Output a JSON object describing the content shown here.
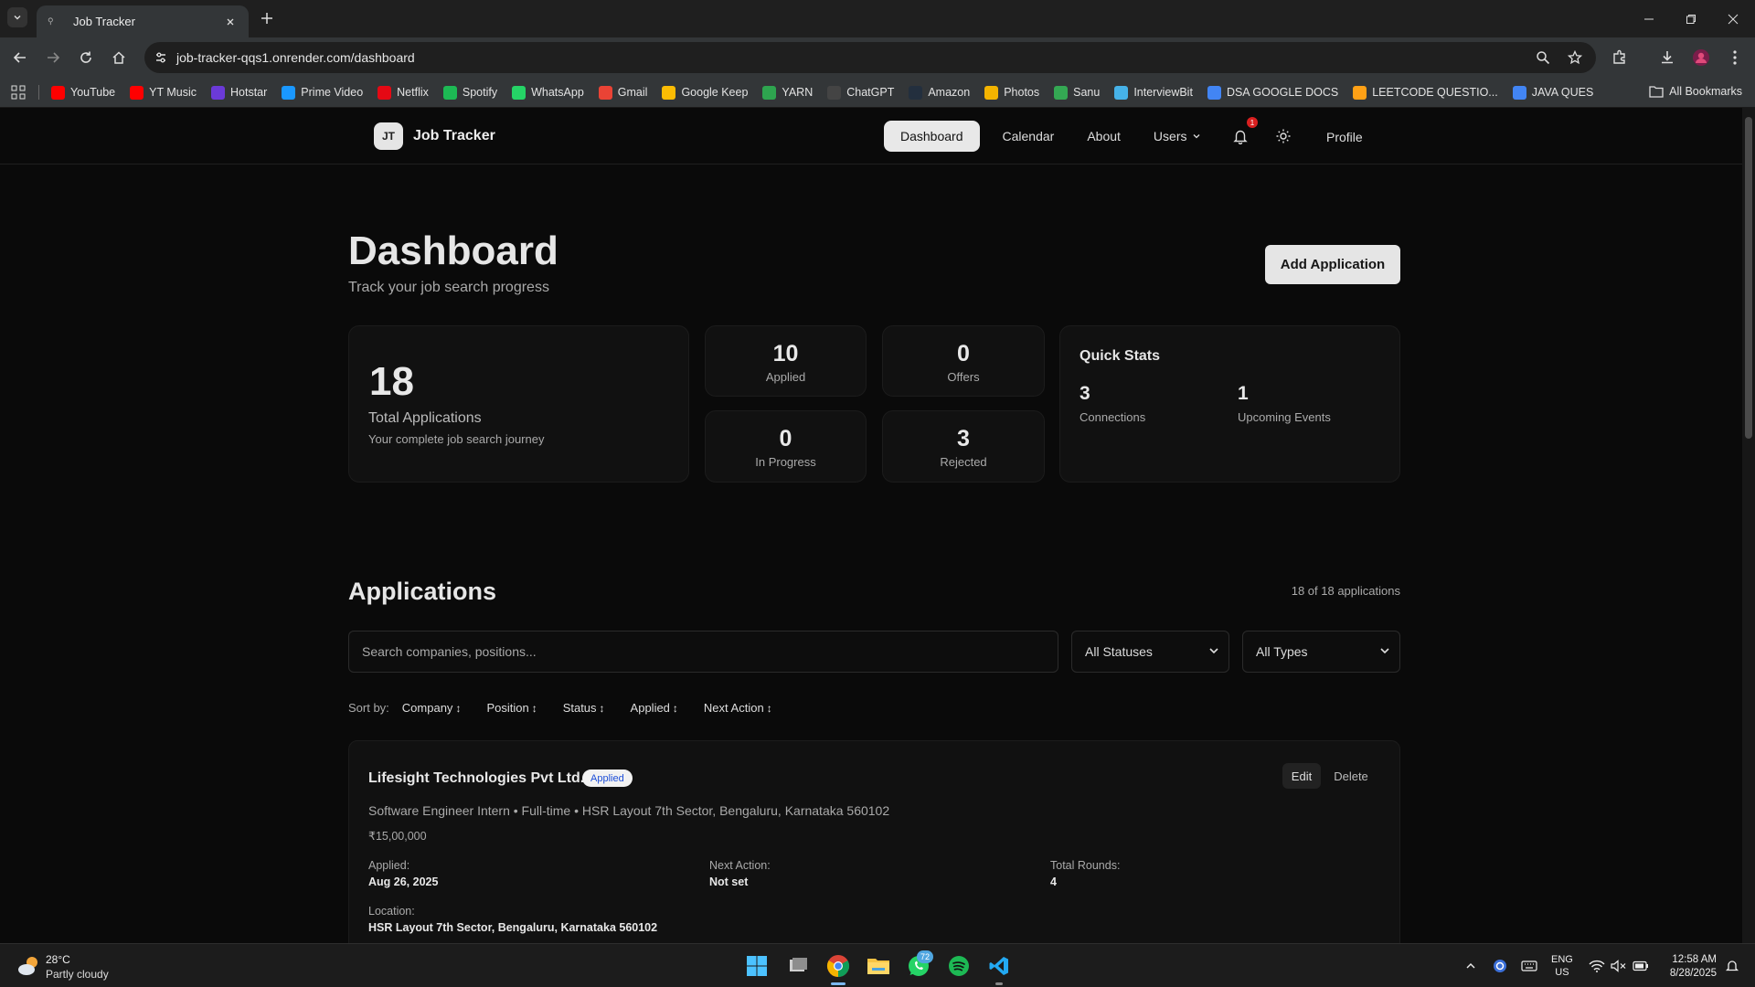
{
  "browser": {
    "tab_title": "Job Tracker",
    "url": "job-tracker-qqs1.onrender.com/dashboard",
    "bookmarks": [
      {
        "label": "YouTube",
        "color": "#ff0000"
      },
      {
        "label": "YT Music",
        "color": "#ff0000"
      },
      {
        "label": "Hotstar",
        "color": "#6b3ad8"
      },
      {
        "label": "Prime Video",
        "color": "#1a98ff"
      },
      {
        "label": "Netflix",
        "color": "#e50914"
      },
      {
        "label": "Spotify",
        "color": "#1db954"
      },
      {
        "label": "WhatsApp",
        "color": "#25d366"
      },
      {
        "label": "Gmail",
        "color": "#ea4335"
      },
      {
        "label": "Google Keep",
        "color": "#fbbc04"
      },
      {
        "label": "YARN",
        "color": "#2ea44f"
      },
      {
        "label": "ChatGPT",
        "color": "#444444"
      },
      {
        "label": "Amazon",
        "color": "#232f3e"
      },
      {
        "label": "Photos",
        "color": "#f4b400"
      },
      {
        "label": "Sanu",
        "color": "#34a853"
      },
      {
        "label": "InterviewBit",
        "color": "#46b2e8"
      },
      {
        "label": "DSA GOOGLE DOCS",
        "color": "#4285f4"
      },
      {
        "label": "LEETCODE QUESTIO...",
        "color": "#ffa116"
      },
      {
        "label": "JAVA QUES",
        "color": "#4285f4"
      }
    ],
    "all_bookmarks": "All Bookmarks"
  },
  "app": {
    "logo": "JT",
    "name": "Job Tracker",
    "nav": {
      "dashboard": "Dashboard",
      "calendar": "Calendar",
      "about": "About",
      "users": "Users",
      "profile": "Profile"
    },
    "notifications_count": "1"
  },
  "dashboard": {
    "title": "Dashboard",
    "subtitle": "Track your job search progress",
    "add_button": "Add Application",
    "total": {
      "value": "18",
      "label": "Total Applications",
      "description": "Your complete job search journey"
    },
    "stats": {
      "applied": {
        "value": "10",
        "label": "Applied"
      },
      "offers": {
        "value": "0",
        "label": "Offers"
      },
      "in_progress": {
        "value": "0",
        "label": "In Progress"
      },
      "rejected": {
        "value": "3",
        "label": "Rejected"
      }
    },
    "quick_stats": {
      "title": "Quick Stats",
      "connections": {
        "value": "3",
        "label": "Connections"
      },
      "events": {
        "value": "1",
        "label": "Upcoming Events"
      }
    }
  },
  "applications": {
    "title": "Applications",
    "count_text": "18 of 18 applications",
    "search_placeholder": "Search companies, positions...",
    "status_filter": "All Statuses",
    "type_filter": "All Types",
    "sort_label": "Sort by:",
    "sort_options": [
      "Company",
      "Position",
      "Status",
      "Applied",
      "Next Action"
    ],
    "items": [
      {
        "company": "Lifesight Technologies Pvt Ltd.",
        "status": "Applied",
        "meta": "Software Engineer Intern • Full-time • HSR Layout 7th Sector, Bengaluru, Karnataka 560102",
        "salary": "₹15,00,000",
        "applied_label": "Applied:",
        "applied_date": "Aug 26, 2025",
        "next_action_label": "Next Action:",
        "next_action": "Not set",
        "rounds_label": "Total Rounds:",
        "rounds": "4",
        "location_label": "Location:",
        "location": "HSR Layout 7th Sector, Bengaluru, Karnataka 560102",
        "edit": "Edit",
        "delete": "Delete"
      }
    ]
  },
  "taskbar": {
    "temperature": "28°C",
    "weather": "Partly cloudy",
    "whatsapp_badge": "72",
    "lang_top": "ENG",
    "lang_bottom": "US",
    "time": "12:58 AM",
    "date": "8/28/2025"
  }
}
